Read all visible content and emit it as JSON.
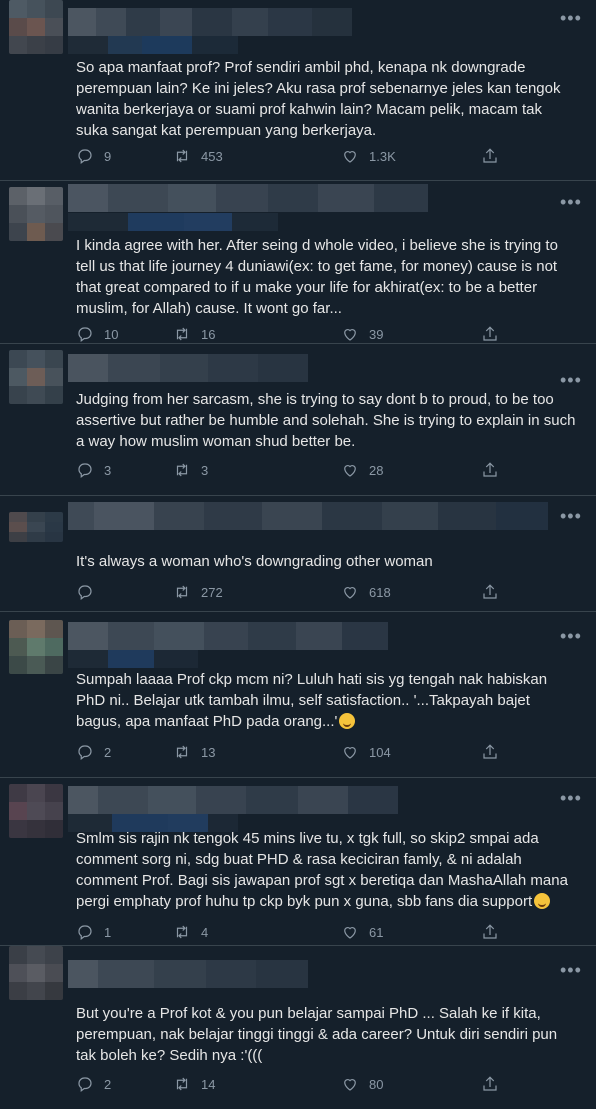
{
  "colors": {
    "background": "#15202b",
    "divider": "#38444d",
    "text": "#e6e6e6",
    "muted": "#8b98a5"
  },
  "more_label": "•••",
  "tweets": [
    {
      "text": "So apa manfaat prof? Prof sendiri ambil phd, kenapa nk downgrade perempuan lain? Ke ini jeles? Aku rasa prof sebenarnye jeles kan tengok wanita berkerjaya or suami prof kahwin lain? Macam pelik, macam tak suka sangat kat perempuan yang berkerjaya.",
      "replies": "9",
      "retweets": "453",
      "likes": "1.3K"
    },
    {
      "text": "I kinda agree with her. After seing d whole video, i believe she is trying to tell us that life journey 4 duniawi(ex: to get fame, for money) cause is not that great compared to if u make your life for akhirat(ex: to be a better muslim, for Allah) cause. It wont go far...",
      "replies": "10",
      "retweets": "16",
      "likes": "39"
    },
    {
      "text": "Judging from her sarcasm, she is trying to say dont b to proud, to be too assertive but rather be humble and solehah. She is trying to explain in such a way how muslim woman shud better be.",
      "replies": "3",
      "retweets": "3",
      "likes": "28"
    },
    {
      "text": "It's always a woman who's downgrading other woman",
      "replies": "",
      "retweets": "272",
      "likes": "618"
    },
    {
      "text": "Sumpah laaaa Prof ckp mcm ni? Luluh hati sis yg tengah nak habiskan PhD ni.. Belajar utk tambah ilmu, self satisfaction.. '...Takpayah bajet bagus, apa manfaat PhD pada orang...'",
      "emoji": "flushed-face-emoji",
      "replies": "2",
      "retweets": "13",
      "likes": "104"
    },
    {
      "text": "Smlm sis rajin nk tengok 45 mins live tu, x tgk full, so skip2 smpai ada comment sorg ni, sdg buat PHD & rasa keciciran famly, & ni adalah comment Prof. Bagi sis jawapan prof sgt x beretiqa dan MashaAllah mana pergi emphaty prof huhu tp ckp byk pun x guna, sbb fans dia support",
      "emoji": "grinning-face-emoji",
      "replies": "1",
      "retweets": "4",
      "likes": "61"
    },
    {
      "text": "But you're a Prof kot & you pun belajar sampai PhD ... Salah ke if kita, perempuan, nak belajar tinggi tinggi & ada career? Untuk diri sendiri pun tak boleh ke? Sedih nya :'(((",
      "replies": "2",
      "retweets": "14",
      "likes": "80"
    }
  ]
}
